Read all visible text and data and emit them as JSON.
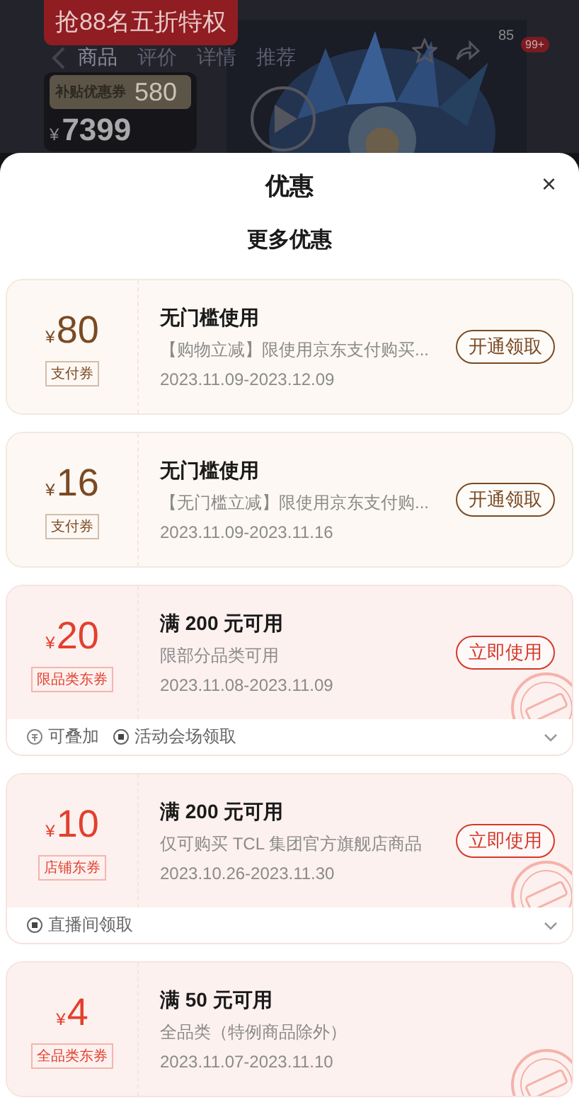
{
  "backdrop": {
    "promo_banner": "抢88名五折特权",
    "tabs": [
      {
        "label": "商品",
        "selected": true
      },
      {
        "label": "评价",
        "selected": false
      },
      {
        "label": "详情",
        "selected": false
      },
      {
        "label": "推荐",
        "selected": false
      }
    ],
    "subsidy_amount": "580",
    "subsidy_label": "补贴优惠券",
    "currency": "¥",
    "price": "7399",
    "size_label": "85",
    "cart_badge": "99+"
  },
  "sheet": {
    "title": "优惠",
    "close": "×",
    "section_title": "更多优惠"
  },
  "coupons": [
    {
      "kind": "pay",
      "currency": "¥",
      "amount": "80",
      "type_tag": "支付券",
      "title": "无门槛使用",
      "desc": "【购物立减】限使用京东支付购买...",
      "dates": "2023.11.09-2023.12.09",
      "action": "开通领取",
      "claimed": false
    },
    {
      "kind": "pay",
      "currency": "¥",
      "amount": "16",
      "type_tag": "支付券",
      "title": "无门槛使用",
      "desc": "【无门槛立减】限使用京东支付购...",
      "dates": "2023.11.09-2023.11.16",
      "action": "开通领取",
      "claimed": false
    },
    {
      "kind": "dong",
      "currency": "¥",
      "amount": "20",
      "type_tag": "限品类东券",
      "title": "满 200 元可用",
      "desc": "限部分品类可用",
      "dates": "2023.11.08-2023.11.09",
      "action": "立即使用",
      "claimed": true,
      "footer": [
        {
          "kind": "stack",
          "label": "可叠加"
        },
        {
          "kind": "venue",
          "label": "活动会场领取"
        }
      ],
      "expanded": false
    },
    {
      "kind": "dong",
      "currency": "¥",
      "amount": "10",
      "type_tag": "店铺东券",
      "title": "满 200 元可用",
      "desc": "仅可购买 TCL 集团官方旗舰店商品",
      "dates": "2023.10.26-2023.11.30",
      "action": "立即使用",
      "claimed": true,
      "footer": [
        {
          "kind": "venue",
          "label": "直播间领取"
        }
      ],
      "expanded": false
    },
    {
      "kind": "dong",
      "currency": "¥",
      "amount": "4",
      "type_tag": "全品类东券",
      "title": "满 50 元可用",
      "desc": "全品类（特例商品除外）",
      "dates": "2023.11.07-2023.11.10",
      "claimed": true
    }
  ]
}
